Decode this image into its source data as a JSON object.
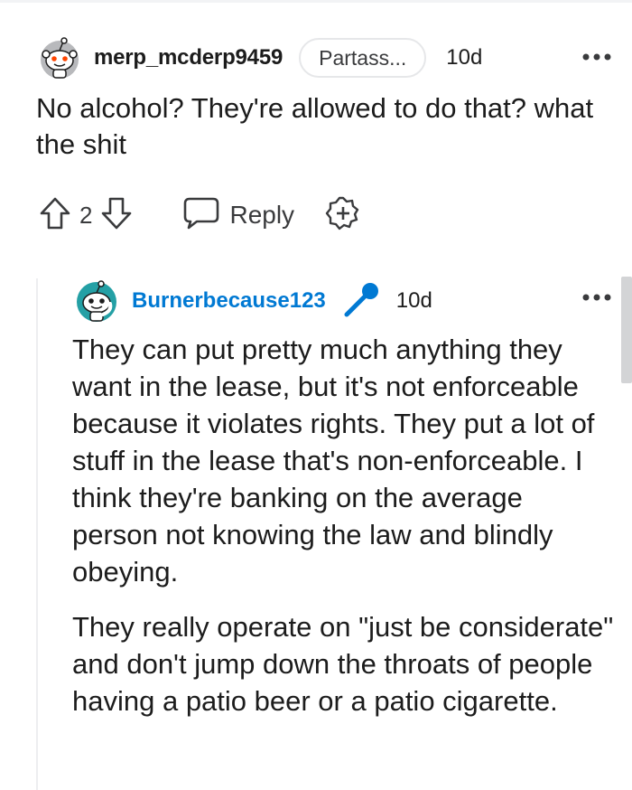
{
  "comment1": {
    "username": "merp_mcderp9459",
    "flair": "Partass...",
    "age": "10d",
    "text": "No alcohol? They're allowed to do that? what the shit",
    "score": "2",
    "reply_label": "Reply"
  },
  "comment2": {
    "username": "Burnerbecause123",
    "age": "10d",
    "paragraphs": [
      "They can put pretty much anything they want in the lease, but it's not enforceable because it violates rights. They put a lot of stuff in the lease that's non-enforceable. I think they're banking on the average person not knowing the law and blindly obeying.",
      "They really operate on \"just be considerate\" and don't jump down the throats of people having a patio beer or a patio cigarette."
    ]
  },
  "colors": {
    "username_link": "#0079d3",
    "icon_gray": "#3a3b3d",
    "thread_line": "#edeef0"
  },
  "icons": {
    "avatar1": "snoo-avatar-icon",
    "avatar2": "snoo-avatar-icon",
    "more": "more-options-icon",
    "upvote": "upvote-arrow-icon",
    "downvote": "downvote-arrow-icon",
    "reply": "speech-bubble-icon",
    "award": "award-plus-icon",
    "mic": "microphone-icon"
  }
}
